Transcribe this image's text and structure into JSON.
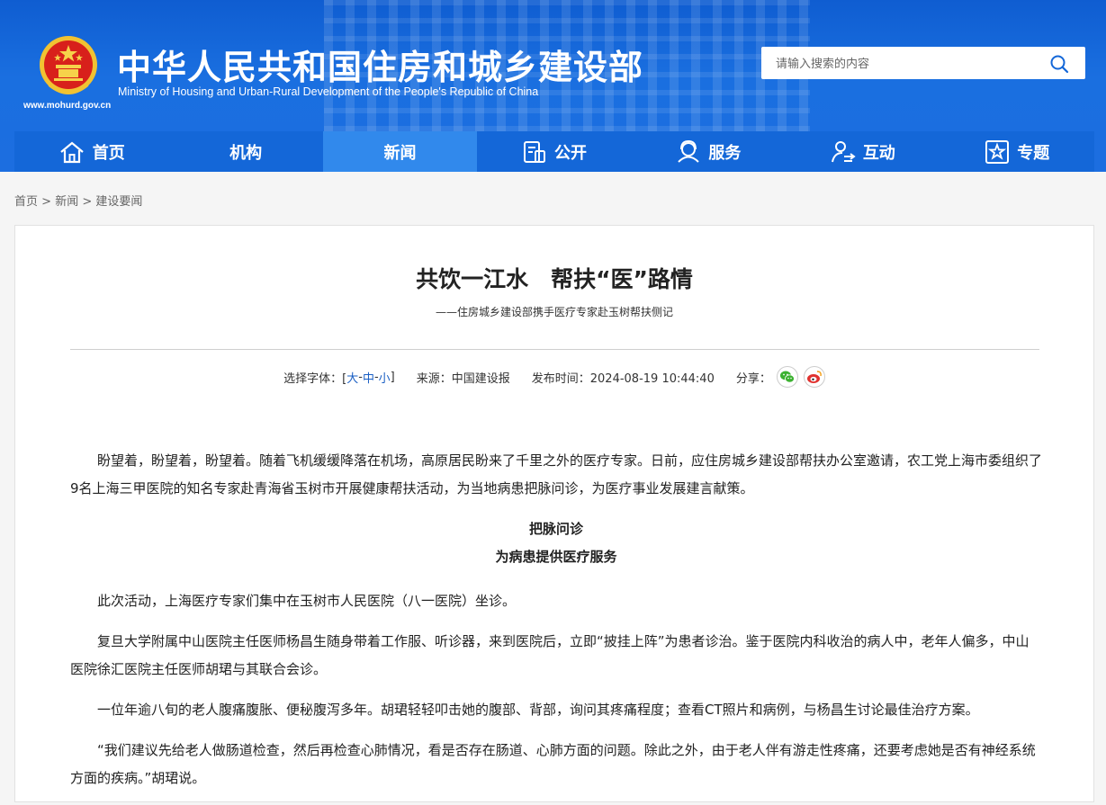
{
  "header": {
    "site_title": "中华人民共和国住房和城乡建设部",
    "site_subtitle": "Ministry of Housing and Urban-Rural Development of the People's Republic of China",
    "site_url": "www.mohurd.gov.cn",
    "search_placeholder": "请输入搜索的内容"
  },
  "nav": {
    "items": [
      {
        "label": "首页",
        "icon": "home-icon"
      },
      {
        "label": "机构",
        "icon": ""
      },
      {
        "label": "新闻",
        "icon": "",
        "active": true
      },
      {
        "label": "公开",
        "icon": "document-icon"
      },
      {
        "label": "服务",
        "icon": "service-icon"
      },
      {
        "label": "互动",
        "icon": "interact-icon"
      },
      {
        "label": "专题",
        "icon": "star-icon"
      }
    ]
  },
  "breadcrumb": {
    "items": [
      "首页",
      "新闻",
      "建设要闻"
    ],
    "sep": ">"
  },
  "article": {
    "title": "共饮一江水　帮扶“医”路情",
    "subtitle": "——住房城乡建设部携手医疗专家赴玉树帮扶侧记",
    "meta": {
      "font_label": "选择字体：[",
      "font_large": "大",
      "font_medium": "中",
      "font_small": "小",
      "font_sep": "-",
      "font_close": "]",
      "source": "来源：中国建设报",
      "published": "发布时间：2024-08-19 10:44:40",
      "share_label": "分享："
    },
    "paragraphs": {
      "p1": "盼望着，盼望着，盼望着。随着飞机缓缓降落在机场，高原居民盼来了千里之外的医疗专家。日前，应住房城乡建设部帮扶办公室邀请，农工党上海市委组织了9名上海三甲医院的知名专家赴青海省玉树市开展健康帮扶活动，为当地病患把脉问诊，为医疗事业发展建言献策。",
      "h1": "把脉问诊",
      "h2": "为病患提供医疗服务",
      "p2": "此次活动，上海医疗专家们集中在玉树市人民医院（八一医院）坐诊。",
      "p3": "复旦大学附属中山医院主任医师杨昌生随身带着工作服、听诊器，来到医院后，立即“披挂上阵”为患者诊治。鉴于医院内科收治的病人中，老年人偏多，中山医院徐汇医院主任医师胡珺与其联合会诊。",
      "p4": "一位年逾八旬的老人腹痛腹胀、便秘腹泻多年。胡珺轻轻叩击她的腹部、背部，询问其疼痛程度；查看CT照片和病例，与杨昌生讨论最佳治疗方案。",
      "p5": "“我们建议先给老人做肠道检查，然后再检查心肺情况，看是否存在肠道、心肺方面的问题。除此之外，由于老人伴有游走性疼痛，还要考虑她是否有神经系统方面的疾病。”胡珺说。"
    }
  },
  "colors": {
    "header_blue": "#1467d8",
    "nav_active": "#3189ec",
    "link_blue": "#1a5fc4",
    "wechat_green": "#3bb12f",
    "weibo_red": "#e0322f"
  }
}
